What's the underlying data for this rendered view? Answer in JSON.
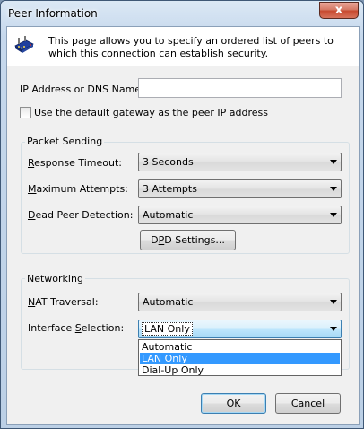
{
  "window": {
    "title": "Peer Information",
    "close_glyph": "x"
  },
  "banner": {
    "icon": "network-adapter-icon",
    "text": "This page allows you to specify an ordered list of peers to which this connection can establish security."
  },
  "peer": {
    "address_label": "IP Address or DNS Name:",
    "address_value": "",
    "default_gateway_label": "Use the default gateway as the peer IP address",
    "default_gateway_checked": false
  },
  "packet_sending": {
    "title": "Packet Sending",
    "response_timeout": {
      "label_ul": "R",
      "label_rest": "esponse Timeout:",
      "value": "3 Seconds"
    },
    "maximum_attempts": {
      "label_ul": "M",
      "label_rest": "aximum Attempts:",
      "value": "3 Attempts"
    },
    "dead_peer_detection": {
      "label_ul": "D",
      "label_rest": "ead Peer Detection:",
      "value": "Automatic"
    },
    "dpd_button": {
      "label_pre": "D",
      "label_ul": "P",
      "label_post": "D Settings..."
    }
  },
  "networking": {
    "title": "Networking",
    "nat_traversal": {
      "label_ul": "N",
      "label_rest": "AT Traversal:",
      "value": "Automatic"
    },
    "interface_selection": {
      "label_pre": "Interface ",
      "label_ul": "S",
      "label_post": "election:",
      "value": "LAN Only",
      "options": [
        "Automatic",
        "LAN Only",
        "Dial-Up Only"
      ],
      "selected_index": 1
    }
  },
  "footer": {
    "ok_label": "OK",
    "cancel_label": "Cancel"
  },
  "colors": {
    "selection": "#3399ff",
    "close_button": "#c74a2f"
  }
}
